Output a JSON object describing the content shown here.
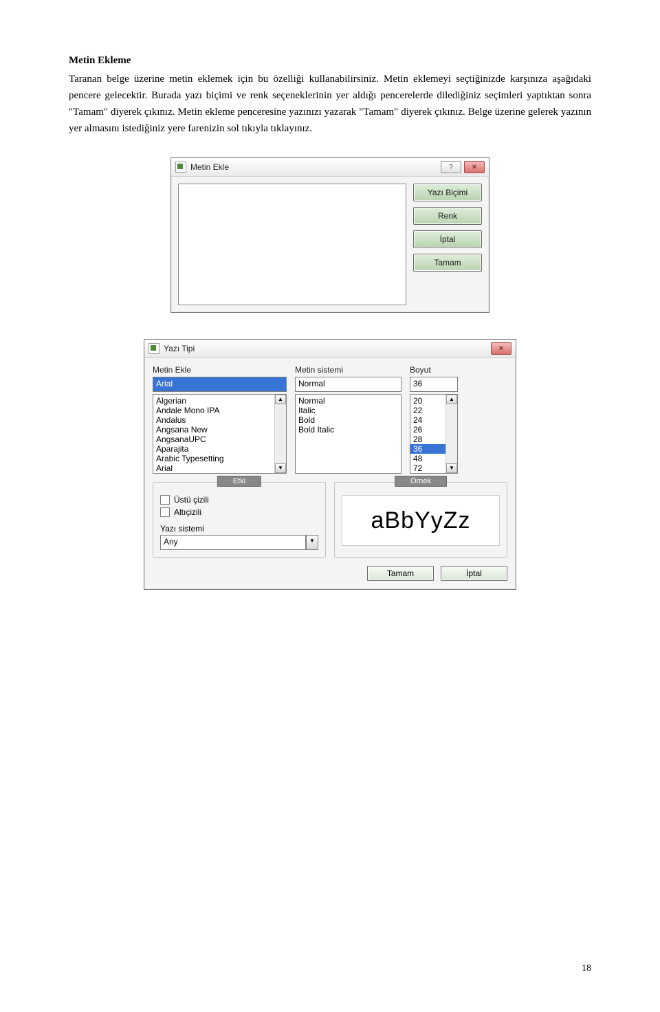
{
  "doc": {
    "heading": "Metin Ekleme",
    "paragraph": "Taranan belge üzerine metin eklemek için bu özelliği kullanabilirsiniz. Metin eklemeyi seçtiğinizde karşınıza aşağıdaki pencere gelecektir. Burada yazı biçimi ve renk seçeneklerinin yer aldığı pencerelerde dilediğiniz seçimleri yaptıktan sonra \"Tamam\" diyerek çıkınız. Metin ekleme penceresine yazınızı yazarak \"Tamam\" diyerek çıkınız. Belge üzerine gelerek yazının yer almasını istediğiniz yere farenizin sol tıkıyla tıklayınız.",
    "page_number": "18"
  },
  "dialog1": {
    "title": "Metin Ekle",
    "buttons": {
      "font": "Yazı Biçimi",
      "color": "Renk",
      "cancel": "İptal",
      "ok": "Tamam"
    }
  },
  "dialog2": {
    "title": "Yazı Tipi",
    "labels": {
      "font_family": "Metin Ekle",
      "font_style": "Metin sistemi",
      "font_size": "Boyut",
      "effects": "Etki",
      "sample": "Örnek",
      "strikeout": "Üstü çizili",
      "underline": "Altıçizili",
      "script": "Yazı sistemi"
    },
    "font_family_value": "Arial",
    "font_family_options": [
      "Algerian",
      "Andale Mono IPA",
      "Andalus",
      "Angsana New",
      "AngsanaUPC",
      "Aparajita",
      "Arabic Typesetting",
      "Arial"
    ],
    "font_style_value": "Normal",
    "font_style_options": [
      "Normal",
      "Italic",
      "Bold",
      "Bold Italic"
    ],
    "font_size_value": "36",
    "font_size_options": [
      "20",
      "22",
      "24",
      "26",
      "28",
      "36",
      "48",
      "72"
    ],
    "script_value": "Any",
    "sample_text": "aBbYyZz",
    "buttons": {
      "ok": "Tamam",
      "cancel": "İptal"
    }
  }
}
